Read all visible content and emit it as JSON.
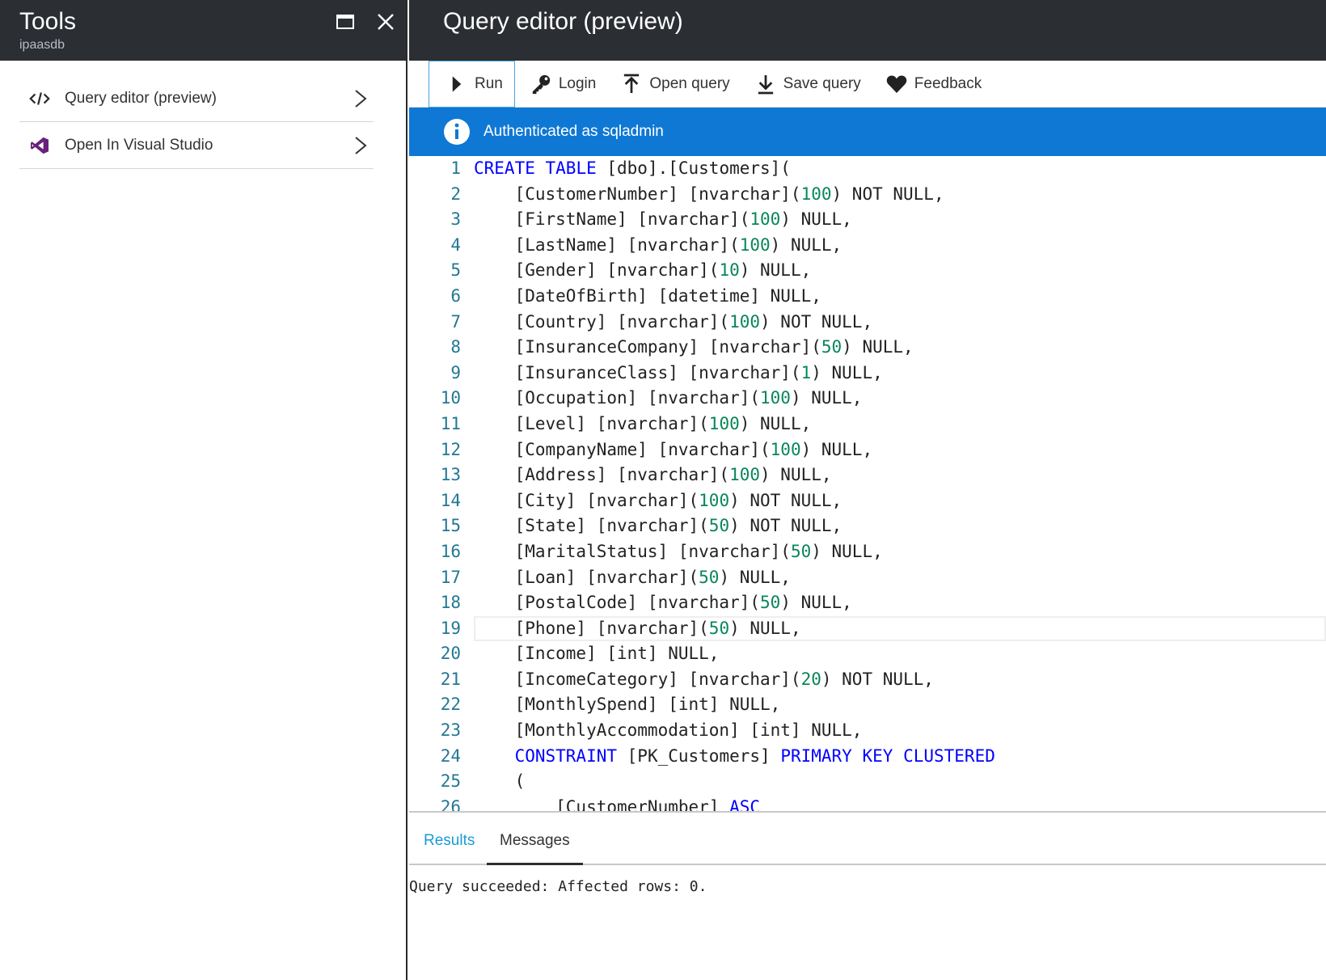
{
  "left_blade": {
    "title": "Tools",
    "subtitle": "ipaasdb",
    "items": [
      {
        "label": "Query editor (preview)",
        "icon": "code-icon"
      },
      {
        "label": "Open In Visual Studio",
        "icon": "visual-studio-icon"
      }
    ]
  },
  "right_blade": {
    "title": "Query editor (preview)",
    "toolbar": {
      "run": "Run",
      "login": "Login",
      "open_query": "Open query",
      "save_query": "Save query",
      "feedback": "Feedback"
    },
    "info": "Authenticated as sqladmin",
    "editor": {
      "active_line": 19,
      "lines": [
        {
          "n": "1",
          "code": "CREATE TABLE [dbo].[Customers]("
        },
        {
          "n": "2",
          "code": "    [CustomerNumber] [nvarchar](100) NOT NULL,"
        },
        {
          "n": "3",
          "code": "    [FirstName] [nvarchar](100) NULL,"
        },
        {
          "n": "4",
          "code": "    [LastName] [nvarchar](100) NULL,"
        },
        {
          "n": "5",
          "code": "    [Gender] [nvarchar](10) NULL,"
        },
        {
          "n": "6",
          "code": "    [DateOfBirth] [datetime] NULL,"
        },
        {
          "n": "7",
          "code": "    [Country] [nvarchar](100) NOT NULL,"
        },
        {
          "n": "8",
          "code": "    [InsuranceCompany] [nvarchar](50) NULL,"
        },
        {
          "n": "9",
          "code": "    [InsuranceClass] [nvarchar](1) NULL,"
        },
        {
          "n": "10",
          "code": "    [Occupation] [nvarchar](100) NULL,"
        },
        {
          "n": "11",
          "code": "    [Level] [nvarchar](100) NULL,"
        },
        {
          "n": "12",
          "code": "    [CompanyName] [nvarchar](100) NULL,"
        },
        {
          "n": "13",
          "code": "    [Address] [nvarchar](100) NULL,"
        },
        {
          "n": "14",
          "code": "    [City] [nvarchar](100) NOT NULL,"
        },
        {
          "n": "15",
          "code": "    [State] [nvarchar](50) NOT NULL,"
        },
        {
          "n": "16",
          "code": "    [MaritalStatus] [nvarchar](50) NULL,"
        },
        {
          "n": "17",
          "code": "    [Loan] [nvarchar](50) NULL,"
        },
        {
          "n": "18",
          "code": "    [PostalCode] [nvarchar](50) NULL,"
        },
        {
          "n": "19",
          "code": "    [Phone] [nvarchar](50) NULL,"
        },
        {
          "n": "20",
          "code": "    [Income] [int] NULL,"
        },
        {
          "n": "21",
          "code": "    [IncomeCategory] [nvarchar](20) NOT NULL,"
        },
        {
          "n": "22",
          "code": "    [MonthlySpend] [int] NULL,"
        },
        {
          "n": "23",
          "code": "    [MonthlyAccommodation] [int] NULL,"
        },
        {
          "n": "24",
          "code": "    CONSTRAINT [PK_Customers] PRIMARY KEY CLUSTERED"
        },
        {
          "n": "25",
          "code": "    ("
        },
        {
          "n": "26",
          "code": "        [CustomerNumber] ASC"
        }
      ]
    },
    "results_tabs": {
      "results": "Results",
      "messages": "Messages"
    },
    "message": "Query succeeded: Affected rows: 0."
  },
  "colors": {
    "header_bg": "#2b2e33",
    "info_bg": "#0f78d4",
    "keyword": "#0000ff",
    "number": "#098658",
    "line_number": "#237893",
    "tab_active_text": "#1a9bd7",
    "vs_purple": "#68217a"
  }
}
